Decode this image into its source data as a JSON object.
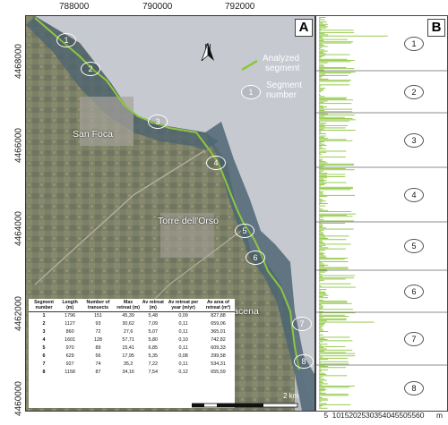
{
  "panels": {
    "a_label": "A",
    "b_label": "B"
  },
  "coords": {
    "x_ticks": [
      "788000",
      "790000",
      "792000"
    ],
    "y_ticks": [
      "4468000",
      "4466000",
      "4464000",
      "4462000",
      "4460000"
    ]
  },
  "legend": {
    "analyzed_line1": "Analyzed",
    "analyzed_line2": "segment",
    "segment_number_symbol": "1",
    "segment_line1": "Segment",
    "segment_line2": "number",
    "segment_line_color": "#8dc63f"
  },
  "north": {
    "label": "N"
  },
  "places": {
    "san_foca": "San Foca",
    "torre_orso": "Torre dell'Orso",
    "torre_saracena": "Torre Saracena"
  },
  "segments": [
    "1",
    "2",
    "3",
    "4",
    "5",
    "6",
    "7",
    "8"
  ],
  "scale": {
    "labels": [
      "0",
      "0.5",
      "1",
      "2 km"
    ]
  },
  "table": {
    "headers": [
      "Segment number",
      "Length (m)",
      "Number of transects",
      "Max retreat (m)",
      "Av retreat (m)",
      "Av retreat per year (m/yr)",
      "Av area of retreat (m²)"
    ],
    "rows": [
      [
        "1",
        "1796",
        "151",
        "45,39",
        "5,48",
        "0,09",
        "827,88"
      ],
      [
        "2",
        "1127",
        "93",
        "30,62",
        "7,09",
        "0,11",
        "659,06"
      ],
      [
        "3",
        "860",
        "72",
        "27,6",
        "5,07",
        "0,11",
        "365,01"
      ],
      [
        "4",
        "1601",
        "128",
        "57,71",
        "5,80",
        "0,10",
        "742,82"
      ],
      [
        "5",
        "970",
        "89",
        "15,41",
        "6,85",
        "0,11",
        "609,33"
      ],
      [
        "6",
        "629",
        "56",
        "17,95",
        "5,35",
        "0,08",
        "299,58"
      ],
      [
        "7",
        "927",
        "74",
        "35,2",
        "7,22",
        "0,11",
        "534,31"
      ],
      [
        "8",
        "1158",
        "87",
        "34,16",
        "7,54",
        "0,12",
        "655,59"
      ]
    ]
  },
  "chart_data": {
    "type": "bar",
    "orientation": "horizontal",
    "x_ticks": [
      "5",
      "10",
      "15",
      "20",
      "25",
      "30",
      "35",
      "40",
      "45",
      "50",
      "55",
      "60"
    ],
    "x_unit": "m",
    "xlim": [
      0,
      60
    ],
    "bar_color": "#8dc63f",
    "segment_labels": [
      "1",
      "2",
      "3",
      "4",
      "5",
      "6",
      "7",
      "8"
    ]
  }
}
